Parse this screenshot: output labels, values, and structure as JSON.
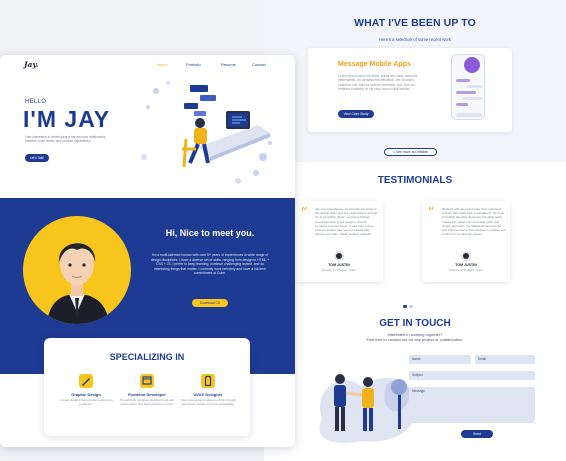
{
  "portfolio": {
    "logo": "Jay.",
    "nav": [
      "Home",
      "Portfolio",
      "Resume",
      "Contact"
    ],
    "active_nav": "Home",
    "hero": {
      "greeting": "HELLO",
      "headline": "I'M JAY",
      "blurb": "I am interested in developing a harmonious relationship between user needs and product capabilities.",
      "cta": "Let's Talk!"
    },
    "about": {
      "heading": "Hi, Nice to meet you.",
      "text": "I'm a multi-talented human with over 5+ years of experiences in wide range of design disciplines. I have a diverse set of skills, ranging from design to HTML + CSS + JS. I prefer to keep learning, continue challenging myself, and do interesting things that matter. I currently work remotely and have a full-time commitment at Cube.",
      "cta": "Download CV"
    },
    "specializing": {
      "heading": "SPECIALIZING IN",
      "skills": [
        {
          "name": "Graphic Design",
          "desc": "I create designs that provide solutions to problems.",
          "icon": "pencil-icon"
        },
        {
          "name": "Frontend Developer",
          "desc": "Thoughtfully designed websites built with performance and best practices in mind.",
          "icon": "code-window-icon"
        },
        {
          "name": "UI/UX Designer",
          "desc": "I like prototyping & helps me think through interaction models and new possibilities.",
          "icon": "phone-icon"
        }
      ]
    }
  },
  "right": {
    "work": {
      "heading": "WHAT I'VE BEEN UP TO",
      "sub": "Here's a selection of some recent work",
      "project_title": "Message Mobile Apps",
      "project_text": "Lorem ipsum dolor sit amet, prima nec case volumus intellegebat, eu persequeris efficiendi, vel id nostro euismod mei. Mel ea viderer nominavi, qui. Quo eu omittam euripidis, ei vis vero consul dicit debitis.",
      "project_cta": "View Case Study",
      "more": "See more at Dribbble"
    },
    "testimonials": {
      "heading": "TESTIMONIALS",
      "items": [
        {
          "quote": "Jay is a powerhouse, an exceptional asset to the design team and our organization at large. He is incredibly driven, a tireless thinker, comprehensive in his designs, and an excellent communicator. It was from a pure process impact was seen immeasurably across our entire mobile product portfolio.",
          "name": "TOM JUSTIN",
          "role": "Director of Product, Cube"
        },
        {
          "quote": "Working with Jay was better than expected and we had really high expectations. He is an incredibly talented developer but what really makes him stand out is his work ethic and clearly approach. He added enhancements and improvements that resulted in a better end product for us and our clients.",
          "name": "TOM JUSTIN",
          "role": "Director of Product, Cube"
        }
      ]
    },
    "contact": {
      "heading": "GET IN TOUCH",
      "sub1": "Interested in working together?",
      "sub2": "Feel free to contact me for any project or collaboration.",
      "name_ph": "Name",
      "email_ph": "Email",
      "subject_ph": "Subject",
      "message_ph": "Message",
      "send": "Send"
    }
  },
  "colors": {
    "navy": "#1d3b93",
    "yellow": "#f7c51b",
    "orange": "#f2a01b"
  }
}
